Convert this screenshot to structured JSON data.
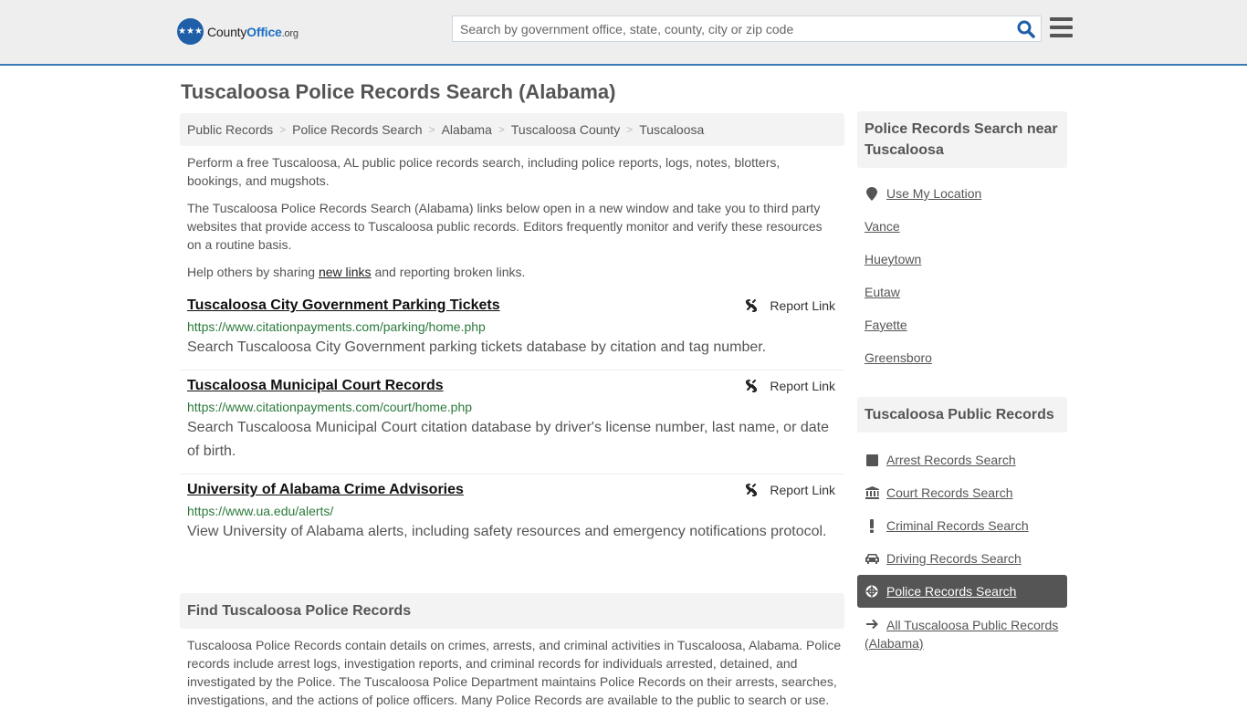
{
  "header": {
    "logo": {
      "prefix": "County",
      "accent": "Office",
      "tld": ".org"
    },
    "search_placeholder": "Search by government office, state, county, city or zip code",
    "search_icon": "search-icon",
    "menu_icon": "hamburger-menu-icon",
    "colors": {
      "accent": "#3a7ab5",
      "logo_blue": "#1e5fa8"
    }
  },
  "page_title": "Tuscaloosa Police Records Search (Alabama)",
  "breadcrumb": [
    {
      "label": "Public Records"
    },
    {
      "label": "Police Records Search"
    },
    {
      "label": "Alabama"
    },
    {
      "label": "Tuscaloosa County"
    },
    {
      "label": "Tuscaloosa"
    }
  ],
  "intro": {
    "p1": "Perform a free Tuscaloosa, AL public police records search, including police reports, logs, notes, blotters, bookings, and mugshots.",
    "p2": "The Tuscaloosa Police Records Search (Alabama) links below open in a new window and take you to third party websites that provide access to Tuscaloosa public records. Editors frequently monitor and verify these resources on a routine basis.",
    "p3_before": "Help others by sharing ",
    "p3_link": "new links",
    "p3_after": " and reporting broken links."
  },
  "results": [
    {
      "title": "Tuscaloosa City Government Parking Tickets",
      "url": "https://www.citationpayments.com/parking/home.php",
      "description": "Search Tuscaloosa City Government parking tickets database by citation and tag number.",
      "report_label": "Report Link"
    },
    {
      "title": "Tuscaloosa Municipal Court Records",
      "url": "https://www.citationpayments.com/court/home.php",
      "description": "Search Tuscaloosa Municipal Court citation database by driver's license number, last name, or date of birth.",
      "report_label": "Report Link"
    },
    {
      "title": "University of Alabama Crime Advisories",
      "url": "https://www.ua.edu/alerts/",
      "description": "View University of Alabama alerts, including safety resources and emergency notifications protocol.",
      "report_label": "Report Link"
    }
  ],
  "find_section": {
    "heading": "Find Tuscaloosa Police Records",
    "text": "Tuscaloosa Police Records contain details on crimes, arrests, and criminal activities in Tuscaloosa, Alabama. Police records include arrest logs, investigation reports, and criminal records for individuals arrested, detained, and investigated by the Police. The Tuscaloosa Police Department maintains Police Records on their arrests, searches, investigations, and the actions of police officers. Many Police Records are available to the public to search or use."
  },
  "sidebar": {
    "nearby": {
      "heading": "Police Records Search near Tuscaloosa",
      "use_location": "Use My Location",
      "places": [
        "Vance",
        "Hueytown",
        "Eutaw",
        "Fayette",
        "Greensboro"
      ]
    },
    "public_records": {
      "heading": "Tuscaloosa Public Records",
      "items": [
        {
          "label": "Arrest Records Search",
          "icon": "square-icon"
        },
        {
          "label": "Court Records Search",
          "icon": "courthouse-icon"
        },
        {
          "label": "Criminal Records Search",
          "icon": "exclamation-icon"
        },
        {
          "label": "Driving Records Search",
          "icon": "car-icon"
        },
        {
          "label": "Police Records Search",
          "icon": "crosshair-icon",
          "active": true
        },
        {
          "label": "All Tuscaloosa Public Records (Alabama)",
          "icon": "arrow-right-icon"
        }
      ]
    }
  }
}
